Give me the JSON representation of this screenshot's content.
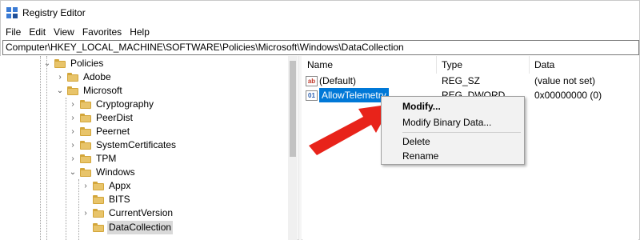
{
  "window": {
    "title": "Registry Editor"
  },
  "menu": [
    "File",
    "Edit",
    "View",
    "Favorites",
    "Help"
  ],
  "address": "Computer\\HKEY_LOCAL_MACHINE\\SOFTWARE\\Policies\\Microsoft\\Windows\\DataCollection",
  "tree": [
    {
      "label": "Policies",
      "expanded": true
    },
    {
      "label": "Adobe",
      "expanded": false
    },
    {
      "label": "Microsoft",
      "expanded": true
    },
    {
      "label": "Cryptography",
      "expanded": false
    },
    {
      "label": "PeerDist",
      "expanded": false
    },
    {
      "label": "Peernet",
      "expanded": false
    },
    {
      "label": "SystemCertificates",
      "expanded": false
    },
    {
      "label": "TPM",
      "expanded": false
    },
    {
      "label": "Windows",
      "expanded": true
    },
    {
      "label": "Appx",
      "expanded": false
    },
    {
      "label": "BITS",
      "expanded": false
    },
    {
      "label": "CurrentVersion",
      "expanded": false
    },
    {
      "label": "DataCollection",
      "expanded": false,
      "selected": true
    }
  ],
  "list": {
    "columns": [
      "Name",
      "Type",
      "Data"
    ],
    "rows": [
      {
        "name": "(Default)",
        "type": "REG_SZ",
        "data": "(value not set)",
        "icon": "string-value-icon"
      },
      {
        "name": "AllowTelemetry",
        "type": "REG_DWORD",
        "data": "0x00000000 (0)",
        "icon": "dword-value-icon",
        "selected": true
      }
    ]
  },
  "context_menu": {
    "items": [
      "Modify...",
      "Modify Binary Data...",
      "Delete",
      "Rename"
    ]
  },
  "colors": {
    "selection": "#0078d7",
    "arrow": "#e8231a",
    "folder": "#e8c46a"
  }
}
